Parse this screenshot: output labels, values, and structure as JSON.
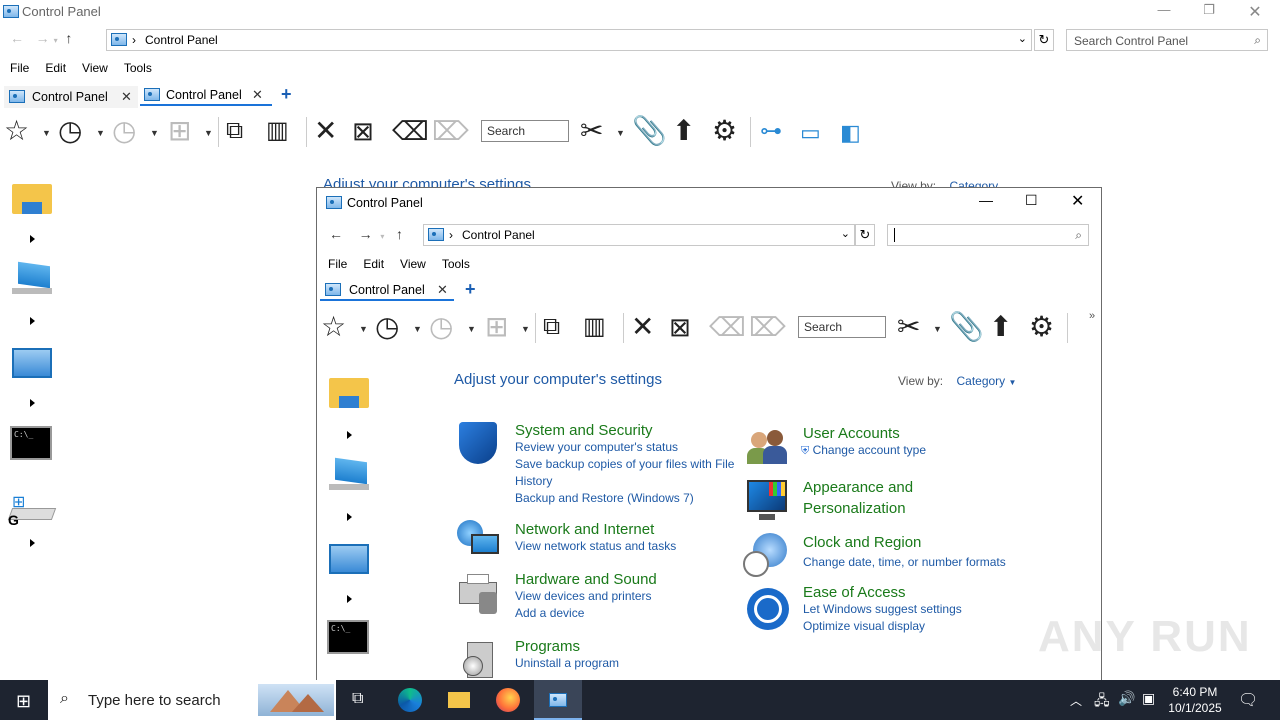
{
  "back_window": {
    "title": "Control Panel",
    "address": "Control Panel",
    "search_placeholder": "Search Control Panel",
    "menu": [
      "File",
      "Edit",
      "View",
      "Tools"
    ],
    "tabs": [
      {
        "label": "Control Panel"
      },
      {
        "label": "Control Panel"
      }
    ],
    "toolbar_search": "Search",
    "heading_partial": "Adjust your computer's settings",
    "viewby_label": "View by:",
    "viewby_value": "Category"
  },
  "front_window": {
    "title": "Control Panel",
    "address": "Control Panel",
    "search_value": "",
    "menu": [
      "File",
      "Edit",
      "View",
      "Tools"
    ],
    "tab_label": "Control Panel",
    "toolbar_search": "Search",
    "heading": "Adjust your computer's settings",
    "viewby_label": "View by:",
    "viewby_value": "Category",
    "categories_left": [
      {
        "name": "System and Security",
        "icon": "shield-icon",
        "links": [
          "Review your computer's status",
          "Save backup copies of your files with File History",
          "Backup and Restore (Windows 7)"
        ]
      },
      {
        "name": "Network and Internet",
        "icon": "network-icon",
        "links": [
          "View network status and tasks"
        ]
      },
      {
        "name": "Hardware and Sound",
        "icon": "printer-icon",
        "links": [
          "View devices and printers",
          "Add a device"
        ]
      },
      {
        "name": "Programs",
        "icon": "programs-icon",
        "links": [
          "Uninstall a program"
        ]
      }
    ],
    "categories_right": [
      {
        "name": "User Accounts",
        "icon": "users-icon",
        "links": [
          "Change account type"
        ]
      },
      {
        "name": "Appearance and Personalization",
        "icon": "monitor-icon",
        "links": []
      },
      {
        "name": "Clock and Region",
        "icon": "clock-globe-icon",
        "links": [
          "Change date, time, or number formats"
        ]
      },
      {
        "name": "Ease of Access",
        "icon": "ease-of-access-icon",
        "links": [
          "Let Windows suggest settings",
          "Optimize visual display"
        ]
      }
    ]
  },
  "taskbar": {
    "search_placeholder": "Type here to search",
    "time": "6:40 PM",
    "date": "10/1/2025"
  },
  "watermark": "ANY RUN",
  "colors": {
    "link": "#1f5aa6",
    "category": "#1a7a1a",
    "taskbar": "#1e2430"
  }
}
